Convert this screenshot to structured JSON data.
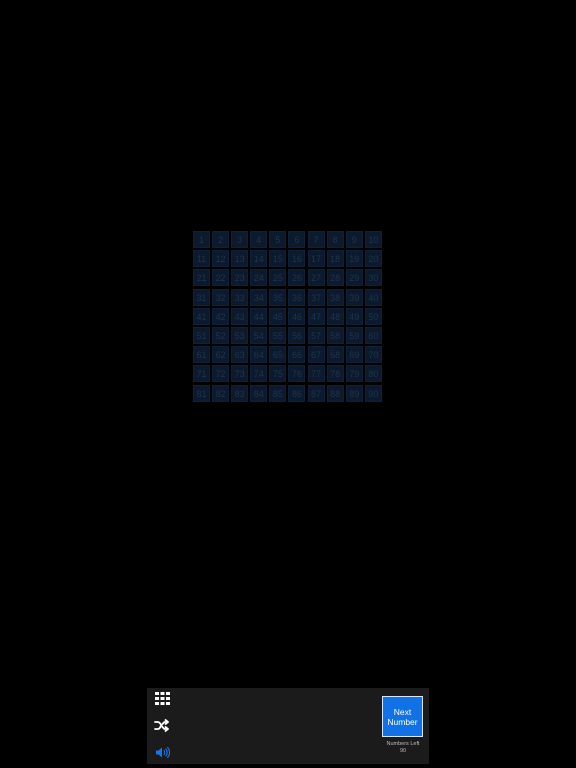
{
  "board": {
    "numbers": [
      1,
      2,
      3,
      4,
      5,
      6,
      7,
      8,
      9,
      10,
      11,
      12,
      13,
      14,
      15,
      16,
      17,
      18,
      19,
      20,
      21,
      22,
      23,
      24,
      25,
      26,
      27,
      28,
      29,
      30,
      31,
      32,
      33,
      34,
      35,
      36,
      37,
      38,
      39,
      40,
      41,
      42,
      43,
      44,
      45,
      46,
      47,
      48,
      49,
      50,
      51,
      52,
      53,
      54,
      55,
      56,
      57,
      58,
      59,
      60,
      61,
      62,
      63,
      64,
      65,
      66,
      67,
      68,
      69,
      70,
      71,
      72,
      73,
      74,
      75,
      76,
      77,
      78,
      79,
      80,
      81,
      82,
      83,
      84,
      85,
      86,
      87,
      88,
      89,
      90
    ]
  },
  "toolbar": {
    "grid_icon": "grid-icon",
    "shuffle_icon": "shuffle-icon",
    "sound_icon": "speaker-icon",
    "next_label": "Next Number",
    "numbers_left_label": "Numbers Left",
    "numbers_left_value": "90"
  },
  "colors": {
    "background": "#000000",
    "cell": "#0b1a2c",
    "accent": "#1172e8",
    "toolbar": "#1b1b1b"
  }
}
